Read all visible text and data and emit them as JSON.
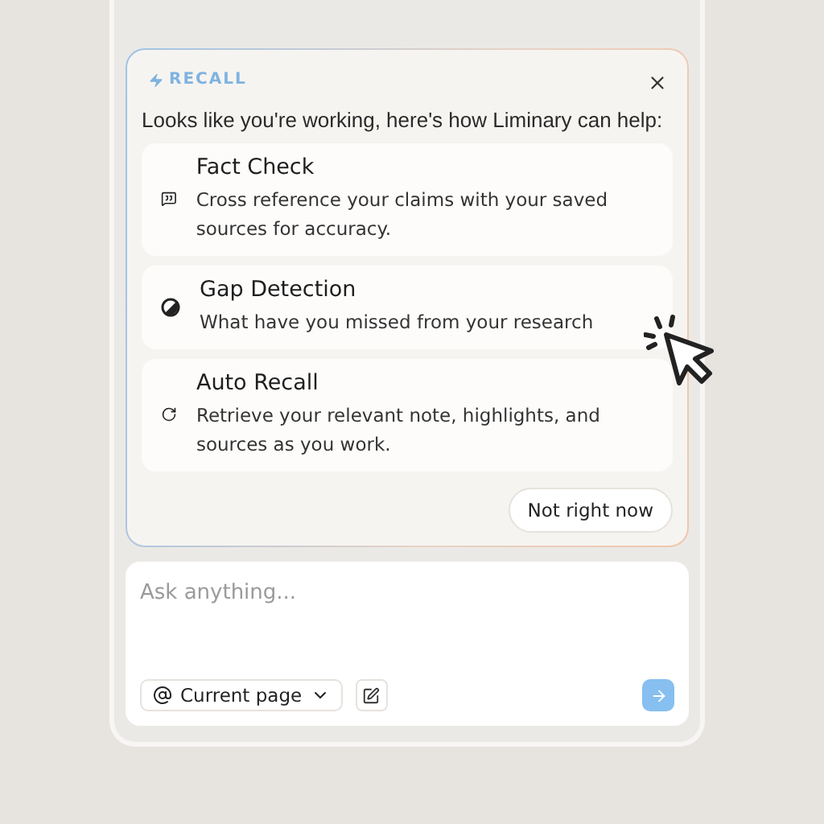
{
  "recall": {
    "label": "RECALL",
    "intro": "Looks like you're working, here's how Liminary can help:",
    "features": [
      {
        "kind": "fact-check",
        "title": "Fact Check",
        "description": "Cross reference your claims with your saved sources for accuracy."
      },
      {
        "kind": "gap",
        "title": "Gap Detection",
        "description": "What have you missed from your research"
      },
      {
        "kind": "recall",
        "title": "Auto Recall",
        "description": "Retrieve your relevant note, highlights, and sources as you work."
      }
    ],
    "dismiss": "Not right now"
  },
  "composer": {
    "placeholder": "Ask anything...",
    "context": "Current page"
  }
}
